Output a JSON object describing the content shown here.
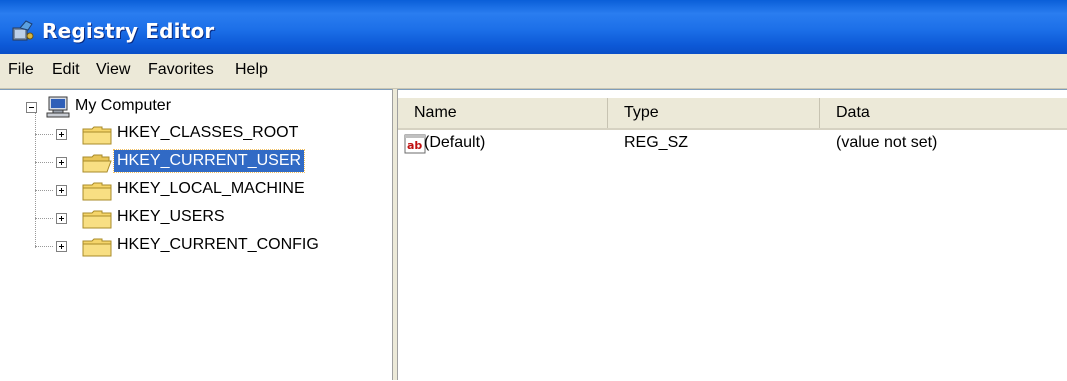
{
  "window": {
    "title": "Registry Editor",
    "app_icon": "registry-editor-icon"
  },
  "menu": [
    "File",
    "Edit",
    "View",
    "Favorites",
    "Help"
  ],
  "tree": {
    "root": {
      "label": "My Computer",
      "icon": "computer-icon",
      "expanded": true
    },
    "keys": [
      {
        "label": "HKEY_CLASSES_ROOT",
        "icon": "folder-icon",
        "selected": false
      },
      {
        "label": "HKEY_CURRENT_USER",
        "icon": "folder-open-icon",
        "selected": true
      },
      {
        "label": "HKEY_LOCAL_MACHINE",
        "icon": "folder-icon",
        "selected": false
      },
      {
        "label": "HKEY_USERS",
        "icon": "folder-icon",
        "selected": false
      },
      {
        "label": "HKEY_CURRENT_CONFIG",
        "icon": "folder-icon",
        "selected": false
      }
    ]
  },
  "list": {
    "columns": [
      "Name",
      "Type",
      "Data"
    ],
    "rows": [
      {
        "icon": "string-value-icon",
        "name": "(Default)",
        "type": "REG_SZ",
        "data": "(value not set)"
      }
    ]
  },
  "colors": {
    "titlebar": "#0a5fd8",
    "selection": "#316ac5",
    "chrome": "#ece9d8"
  }
}
